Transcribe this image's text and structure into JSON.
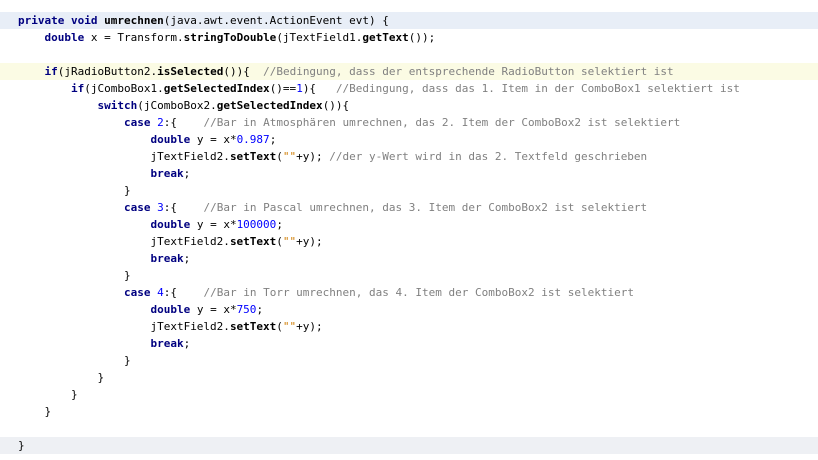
{
  "editor": {
    "language": "java",
    "colors": {
      "keyword": "#000080",
      "number": "#0000ff",
      "comment": "#808080",
      "string": "#ce7b00",
      "current_line": "#fbfbe4",
      "method_header": "#e8eef7"
    },
    "lines": [
      {
        "highlight": "blue",
        "indent": 0,
        "tokens": [
          [
            "kw",
            "private"
          ],
          [
            "t",
            " "
          ],
          [
            "kw",
            "void"
          ],
          [
            "t",
            " "
          ],
          [
            "mb",
            "umrechnen"
          ],
          [
            "t",
            "(java.awt.event.ActionEvent evt) {"
          ]
        ]
      },
      {
        "indent": 1,
        "tokens": [
          [
            "kw",
            "double"
          ],
          [
            "t",
            " x = Transform."
          ],
          [
            "mb",
            "stringToDouble"
          ],
          [
            "t",
            "(jTextField1."
          ],
          [
            "mb",
            "getText"
          ],
          [
            "t",
            "());"
          ]
        ]
      },
      {
        "indent": 0,
        "tokens": []
      },
      {
        "highlight": "yellow",
        "indent": 1,
        "tokens": [
          [
            "kw",
            "if"
          ],
          [
            "t",
            "(jRadioButton2."
          ],
          [
            "mb",
            "isSelected"
          ],
          [
            "t",
            "()){  "
          ],
          [
            "cmt",
            "//Bedingung, dass der entsprechende RadioButton selektiert ist"
          ]
        ]
      },
      {
        "indent": 2,
        "tokens": [
          [
            "kw",
            "if"
          ],
          [
            "t",
            "(jComboBox1."
          ],
          [
            "mb",
            "getSelectedIndex"
          ],
          [
            "t",
            "()=="
          ],
          [
            "num",
            "1"
          ],
          [
            "t",
            "){   "
          ],
          [
            "cmt",
            "//Bedingung, dass das 1. Item in der ComboBox1 selektiert ist"
          ]
        ]
      },
      {
        "indent": 3,
        "tokens": [
          [
            "kw",
            "switch"
          ],
          [
            "t",
            "(jComboBox2."
          ],
          [
            "mb",
            "getSelectedIndex"
          ],
          [
            "t",
            "()){"
          ]
        ]
      },
      {
        "indent": 4,
        "tokens": [
          [
            "kw",
            "case"
          ],
          [
            "t",
            " "
          ],
          [
            "num",
            "2"
          ],
          [
            "t",
            ":{    "
          ],
          [
            "cmt",
            "//Bar in Atmosphären umrechnen, das 2. Item der ComboBox2 ist selektiert"
          ]
        ]
      },
      {
        "indent": 5,
        "tokens": [
          [
            "kw",
            "double"
          ],
          [
            "t",
            " y = x*"
          ],
          [
            "num",
            "0.987"
          ],
          [
            "t",
            ";"
          ]
        ]
      },
      {
        "indent": 5,
        "tokens": [
          [
            "t",
            "jTextField2."
          ],
          [
            "mb",
            "setText"
          ],
          [
            "t",
            "("
          ],
          [
            "str",
            "\"\""
          ],
          [
            "t",
            "+y); "
          ],
          [
            "cmt",
            "//der y-Wert wird in das 2. Textfeld geschrieben"
          ]
        ]
      },
      {
        "indent": 5,
        "tokens": [
          [
            "kw",
            "break"
          ],
          [
            "t",
            ";"
          ]
        ]
      },
      {
        "indent": 4,
        "tokens": [
          [
            "t",
            "}"
          ]
        ]
      },
      {
        "indent": 4,
        "tokens": [
          [
            "kw",
            "case"
          ],
          [
            "t",
            " "
          ],
          [
            "num",
            "3"
          ],
          [
            "t",
            ":{    "
          ],
          [
            "cmt",
            "//Bar in Pascal umrechnen, das 3. Item der ComboBox2 ist selektiert"
          ]
        ]
      },
      {
        "indent": 5,
        "tokens": [
          [
            "kw",
            "double"
          ],
          [
            "t",
            " y = x*"
          ],
          [
            "num",
            "100000"
          ],
          [
            "t",
            ";"
          ]
        ]
      },
      {
        "indent": 5,
        "tokens": [
          [
            "t",
            "jTextField2."
          ],
          [
            "mb",
            "setText"
          ],
          [
            "t",
            "("
          ],
          [
            "str",
            "\"\""
          ],
          [
            "t",
            "+y);"
          ]
        ]
      },
      {
        "indent": 5,
        "tokens": [
          [
            "kw",
            "break"
          ],
          [
            "t",
            ";"
          ]
        ]
      },
      {
        "indent": 4,
        "tokens": [
          [
            "t",
            "}"
          ]
        ]
      },
      {
        "indent": 4,
        "tokens": [
          [
            "kw",
            "case"
          ],
          [
            "t",
            " "
          ],
          [
            "num",
            "4"
          ],
          [
            "t",
            ":{    "
          ],
          [
            "cmt",
            "//Bar in Torr umrechnen, das 4. Item der ComboBox2 ist selektiert"
          ]
        ]
      },
      {
        "indent": 5,
        "tokens": [
          [
            "kw",
            "double"
          ],
          [
            "t",
            " y = x*"
          ],
          [
            "num",
            "750"
          ],
          [
            "t",
            ";"
          ]
        ]
      },
      {
        "indent": 5,
        "tokens": [
          [
            "t",
            "jTextField2."
          ],
          [
            "mb",
            "setText"
          ],
          [
            "t",
            "("
          ],
          [
            "str",
            "\"\""
          ],
          [
            "t",
            "+y);"
          ]
        ]
      },
      {
        "indent": 5,
        "tokens": [
          [
            "kw",
            "break"
          ],
          [
            "t",
            ";"
          ]
        ]
      },
      {
        "indent": 4,
        "tokens": [
          [
            "t",
            "}"
          ]
        ]
      },
      {
        "indent": 3,
        "tokens": [
          [
            "t",
            "}"
          ]
        ]
      },
      {
        "indent": 2,
        "tokens": [
          [
            "t",
            "}"
          ]
        ]
      },
      {
        "indent": 1,
        "tokens": [
          [
            "t",
            "}"
          ]
        ]
      },
      {
        "indent": 0,
        "tokens": []
      },
      {
        "highlight": "gray",
        "indent": 0,
        "tokens": [
          [
            "t",
            "}"
          ]
        ]
      }
    ]
  }
}
